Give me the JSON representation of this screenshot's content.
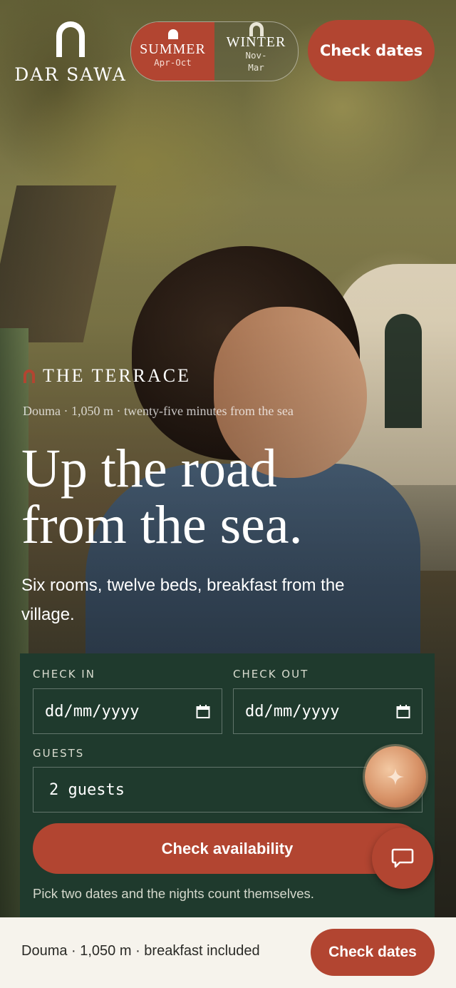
{
  "brand": {
    "name": "DAR SAWA",
    "logo_icon": "arch-icon"
  },
  "season_toggle": {
    "summer": {
      "label": "SUMMER",
      "range": "Apr-Oct",
      "selected": true
    },
    "winter": {
      "label": "WINTER",
      "range": "Nov-\nMar",
      "selected": false
    }
  },
  "header": {
    "cta_label": "Check dates"
  },
  "hero": {
    "eyebrow": "THE TERRACE",
    "meta": "Douma · 1,050 m · twenty-five minutes from the sea",
    "headline_line1": "Up the road",
    "headline_line2": "from the sea.",
    "subhead": "Six rooms, twelve beds, breakfast from the village."
  },
  "booking": {
    "check_in_label": "CHECK IN",
    "check_in_placeholder": "dd/mm/yyyy",
    "check_out_label": "CHECK OUT",
    "check_out_placeholder": "dd/mm/yyyy",
    "guests_label": "GUESTS",
    "guests_value": "2 guests",
    "submit_label": "Check availability",
    "hint": "Pick two dates and the nights count themselves."
  },
  "floating": {
    "assistant_icon": "sparkle-icon",
    "chat_icon": "chat-bubble-icon"
  },
  "bottom_bar": {
    "info": "Douma · 1,050 m · breakfast included",
    "cta_label": "Check dates"
  },
  "colors": {
    "accent": "#b24531",
    "panel": "#1f3a2d",
    "bar_bg": "#f6f3ec"
  }
}
